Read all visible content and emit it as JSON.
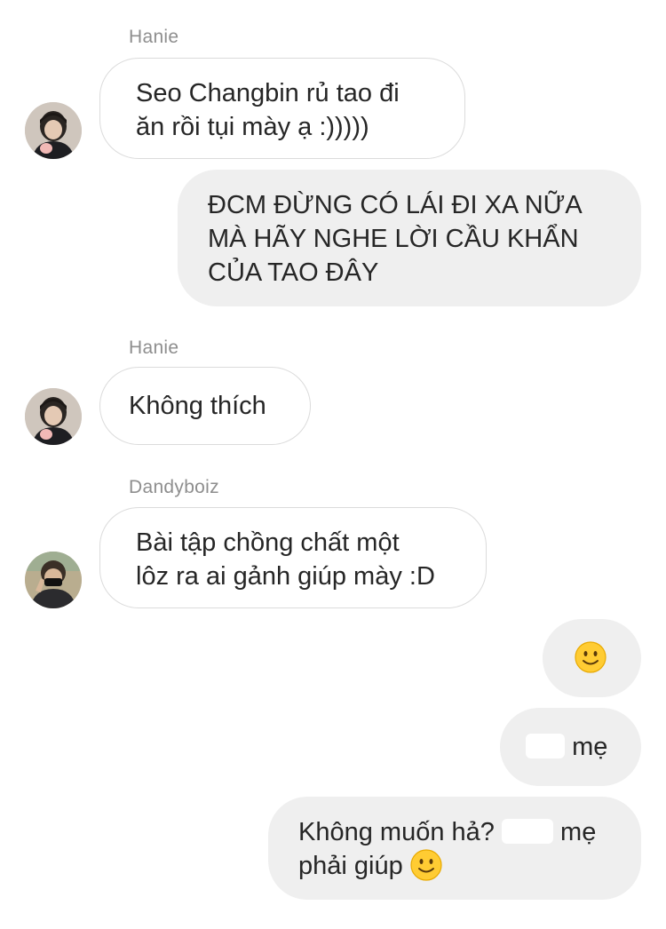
{
  "conversation": {
    "messages": [
      {
        "sender": "Hanie",
        "direction": "incoming",
        "lines": [
          "Seo Changbin rủ tao đi",
          "ăn rồi tụi mày ạ :)))))"
        ]
      },
      {
        "direction": "outgoing",
        "lines": [
          "ĐCM ĐỪNG CÓ LÁI ĐI XA NỮA",
          "MÀ HÃY NGHE LỜI CẦU KHẨN",
          "CỦA TAO ĐÂY"
        ]
      },
      {
        "sender": "Hanie",
        "direction": "incoming",
        "lines": [
          "Không thích"
        ]
      },
      {
        "sender": "Dandyboiz",
        "direction": "incoming",
        "lines": [
          "Bài tập chồng chất một",
          "lôz ra ai gảnh giúp mày :D"
        ]
      },
      {
        "direction": "outgoing",
        "emoji": "slightly-smiling-face-icon"
      },
      {
        "direction": "outgoing",
        "text_visible": "mẹ",
        "note_redacted_prefix": true
      },
      {
        "direction": "outgoing",
        "line1_start": "Không muốn hả?",
        "line1_end": "mẹ",
        "line2": "phải giúp",
        "emoji": "slightly-smiling-face-icon"
      }
    ]
  },
  "colors": {
    "incoming_border": "#dbdbdb",
    "outgoing_bg": "#efefef",
    "sender_name": "#8e8e8e",
    "text": "#262626"
  }
}
